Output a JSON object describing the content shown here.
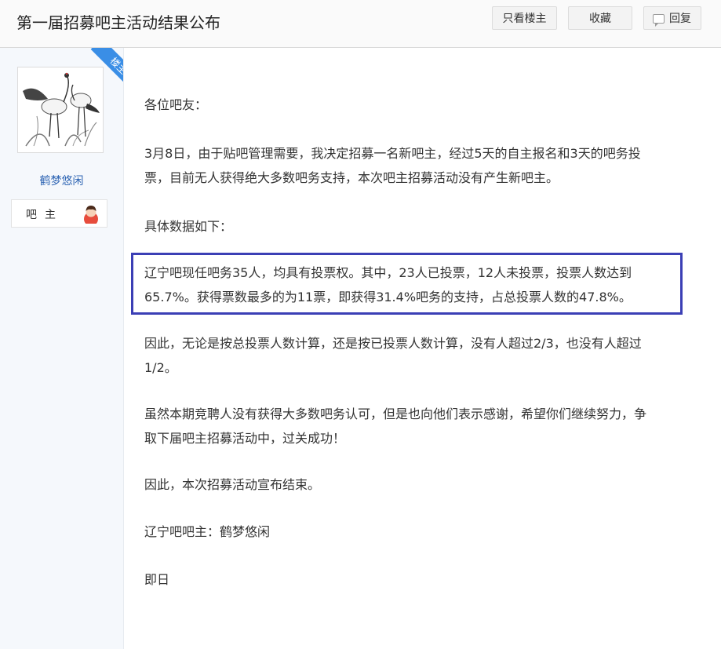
{
  "header": {
    "title": "第一届招募吧主活动结果公布",
    "only_author_label": "只看楼主",
    "favorite_label": "收藏",
    "reply_label": "回复"
  },
  "author": {
    "badge_label": "楼主",
    "username": "鹤梦悠闲",
    "role_label": "吧主"
  },
  "post": {
    "greeting": "各位吧友：",
    "paragraph1_line1": "3月8日，由于贴吧管理需要，我决定招募一名新吧主，经过5天的自主报名和3天的吧务投",
    "paragraph1_line2": "票，目前无人获得绝大多数吧务支持，本次吧主招募活动没有产生新吧主。",
    "data_intro": "具体数据如下：",
    "highlight_line1": "辽宁吧现任吧务35人，均具有投票权。其中，23人已投票，12人未投票，投票人数达到",
    "highlight_line2": "65.7%。获得票数最多的为11票，即获得31.4%吧务的支持，占总投票人数的47.8%。",
    "paragraph3_line1": "因此，无论是按总投票人数计算，还是按已投票人数计算，没有人超过2/3，也没有人超过",
    "paragraph3_line2": "1/2。",
    "paragraph4_line1": "虽然本期竞聘人没有获得大多数吧务认可，但是也向他们表示感谢，希望你们继续努力，争",
    "paragraph4_line2": "取下届吧主招募活动中，过关成功！",
    "paragraph5": "因此，本次招募活动宣布结束。",
    "signature": "辽宁吧吧主：鹤梦悠闲",
    "date": "即日"
  },
  "colors": {
    "highlight_border": "#3b3fb5",
    "username": "#2d64b3",
    "badge": "#3a8ee6"
  },
  "icons": {
    "avatar": "crane-ink-painting",
    "role": "user-avatar-icon",
    "reply": "comment-bubble-icon"
  }
}
